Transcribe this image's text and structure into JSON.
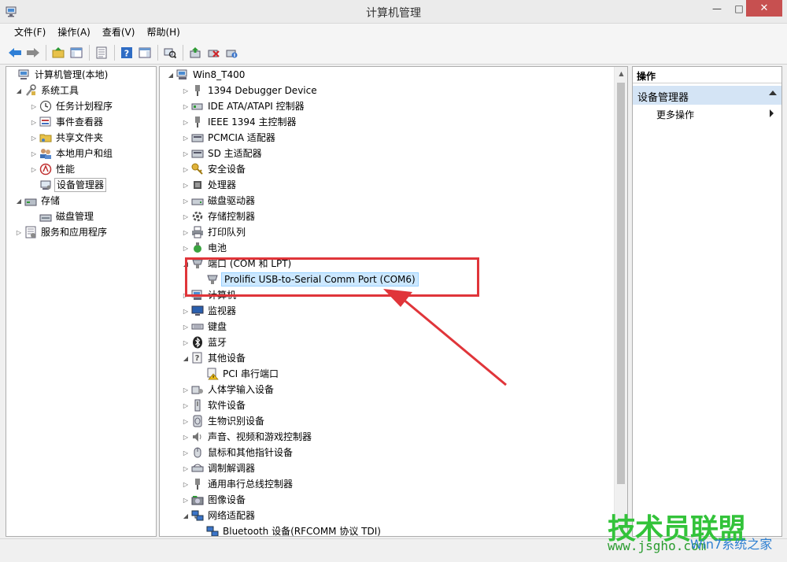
{
  "window": {
    "title": "计算机管理"
  },
  "menu": [
    {
      "label": "文件(F)"
    },
    {
      "label": "操作(A)"
    },
    {
      "label": "查看(V)"
    },
    {
      "label": "帮助(H)"
    }
  ],
  "left_tree": [
    {
      "label": "计算机管理(本地)"
    },
    {
      "label": "系统工具"
    },
    {
      "label": "任务计划程序"
    },
    {
      "label": "事件查看器"
    },
    {
      "label": "共享文件夹"
    },
    {
      "label": "本地用户和组"
    },
    {
      "label": "性能"
    },
    {
      "label": "设备管理器"
    },
    {
      "label": "存储"
    },
    {
      "label": "磁盘管理"
    },
    {
      "label": "服务和应用程序"
    }
  ],
  "device_tree": [
    {
      "label": "Win8_T400"
    },
    {
      "label": "1394 Debugger Device"
    },
    {
      "label": "IDE ATA/ATAPI 控制器"
    },
    {
      "label": "IEEE 1394 主控制器"
    },
    {
      "label": "PCMCIA 适配器"
    },
    {
      "label": "SD 主适配器"
    },
    {
      "label": "安全设备"
    },
    {
      "label": "处理器"
    },
    {
      "label": "磁盘驱动器"
    },
    {
      "label": "存储控制器"
    },
    {
      "label": "打印队列"
    },
    {
      "label": "电池"
    },
    {
      "label": "端口 (COM 和 LPT)"
    },
    {
      "label": "Prolific USB-to-Serial Comm Port (COM6)"
    },
    {
      "label": "计算机"
    },
    {
      "label": "监视器"
    },
    {
      "label": "键盘"
    },
    {
      "label": "蓝牙"
    },
    {
      "label": "其他设备"
    },
    {
      "label": "PCI 串行端口"
    },
    {
      "label": "人体学输入设备"
    },
    {
      "label": "软件设备"
    },
    {
      "label": "生物识别设备"
    },
    {
      "label": "声音、视频和游戏控制器"
    },
    {
      "label": "鼠标和其他指针设备"
    },
    {
      "label": "调制解调器"
    },
    {
      "label": "通用串行总线控制器"
    },
    {
      "label": "图像设备"
    },
    {
      "label": "网络适配器"
    },
    {
      "label": "Bluetooth 设备(RFCOMM 协议 TDI)"
    }
  ],
  "actions": {
    "header": "操作",
    "group": "设备管理器",
    "more": "更多操作"
  },
  "watermark": {
    "brand": "技术员联盟",
    "url": "www.jsgho.com",
    "win": "Win7系统之家"
  },
  "colors": {
    "annotation": "#e0353a",
    "highlight": "#cce8ff",
    "close": "#c75050"
  }
}
